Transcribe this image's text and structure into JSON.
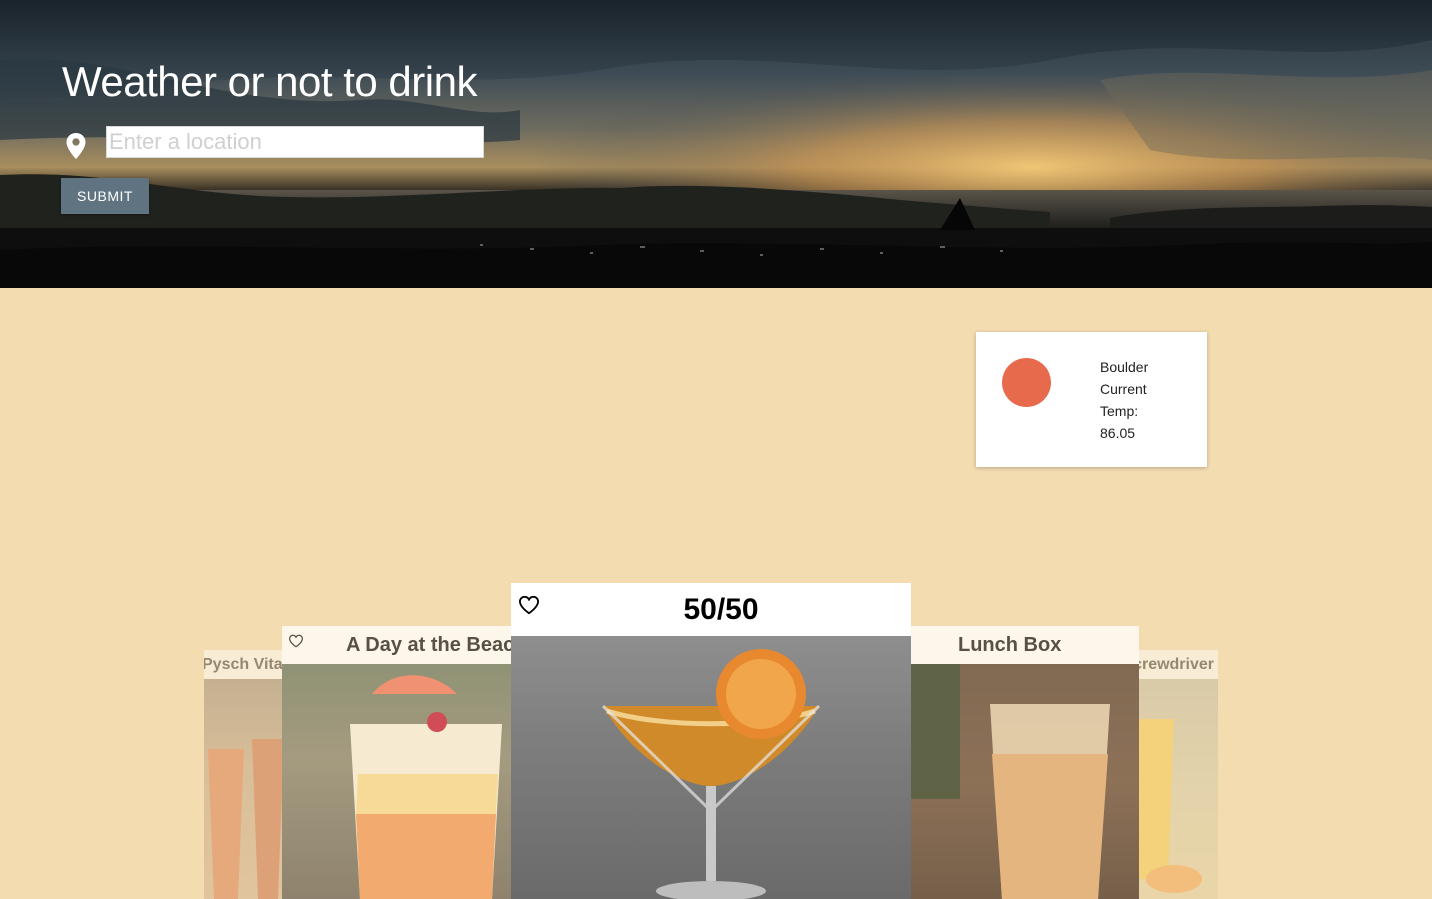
{
  "header": {
    "title": "Weather or not to drink",
    "location_placeholder": "Enter a location",
    "submit_label": "SUBMIT",
    "pin_icon": "map-pin-icon"
  },
  "weather": {
    "city": "Boulder",
    "line2": "Current",
    "line3": "Temp:",
    "temp": "86.05",
    "indicator_color": "#e86a4c"
  },
  "carousel": {
    "cards": [
      {
        "title": "Pysch Vitamin Light",
        "favorite_icon": "heart-outline-icon"
      },
      {
        "title": "A Day at the Beach",
        "favorite_icon": "heart-outline-icon"
      },
      {
        "title": "50/50",
        "favorite_icon": "heart-outline-icon"
      },
      {
        "title": "Lunch Box",
        "favorite_icon": "heart-outline-icon"
      },
      {
        "title": "Screwdriver",
        "favorite_icon": "heart-outline-icon"
      }
    ]
  },
  "colors": {
    "background": "#f4dcb1",
    "submit_button": "#5f7380",
    "card_header": "#ffffff"
  }
}
